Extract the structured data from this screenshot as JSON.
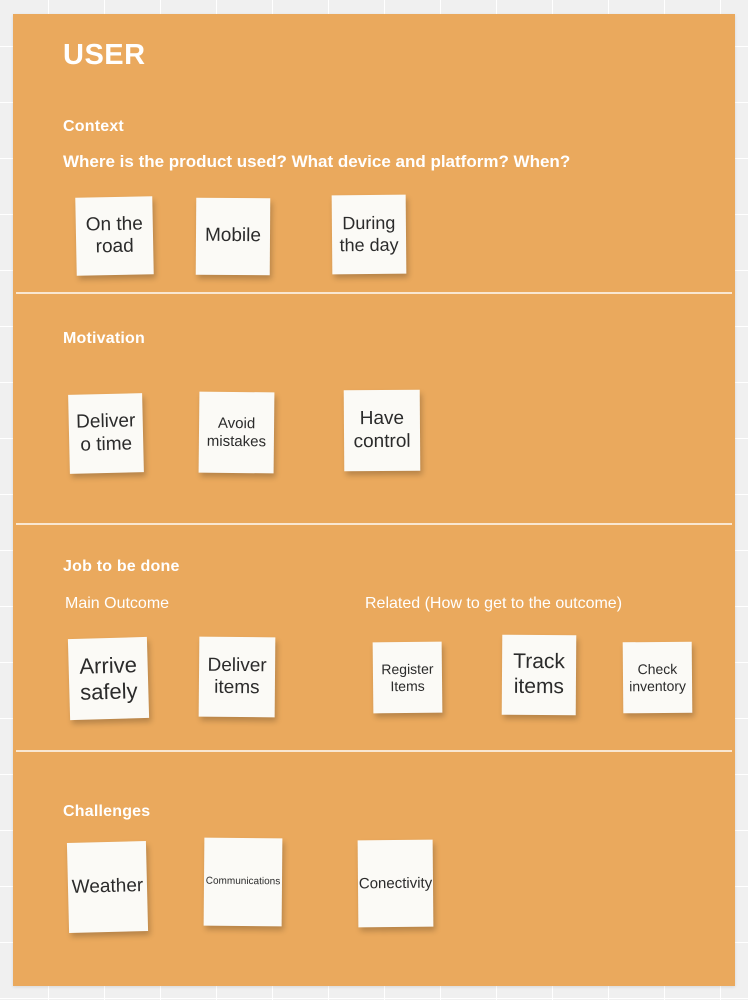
{
  "board": {
    "title": "USER",
    "accent_color": "#eaa95d",
    "card_color": "#fbfaf6",
    "text_color": "#ffffff"
  },
  "sections": [
    {
      "id": "context",
      "heading": "Context",
      "prompt": "Where is the product used? What device and platform? When?",
      "cards": [
        {
          "text": "On the\nroad"
        },
        {
          "text": "Mobile"
        },
        {
          "text": "During\nthe day"
        }
      ]
    },
    {
      "id": "motivation",
      "heading": "Motivation",
      "cards": [
        {
          "text": "Deliver\no time"
        },
        {
          "text": "Avoid\nmistakes"
        },
        {
          "text": "Have\ncontrol"
        }
      ]
    },
    {
      "id": "job-to-be-done",
      "heading": "Job to be done",
      "columns": [
        {
          "label": "Main Outcome"
        },
        {
          "label": "Related (How to get to the outcome)"
        }
      ],
      "cards": [
        {
          "text": "Arrive\nsafely"
        },
        {
          "text": "Deliver\nitems"
        },
        {
          "text": "Register\nItems"
        },
        {
          "text": "Track\nitems"
        },
        {
          "text": "Check\ninventory"
        }
      ]
    },
    {
      "id": "challenges",
      "heading": "Challenges",
      "cards": [
        {
          "text": "Weather"
        },
        {
          "text": "Communications"
        },
        {
          "text": "Conectivity"
        }
      ]
    }
  ]
}
